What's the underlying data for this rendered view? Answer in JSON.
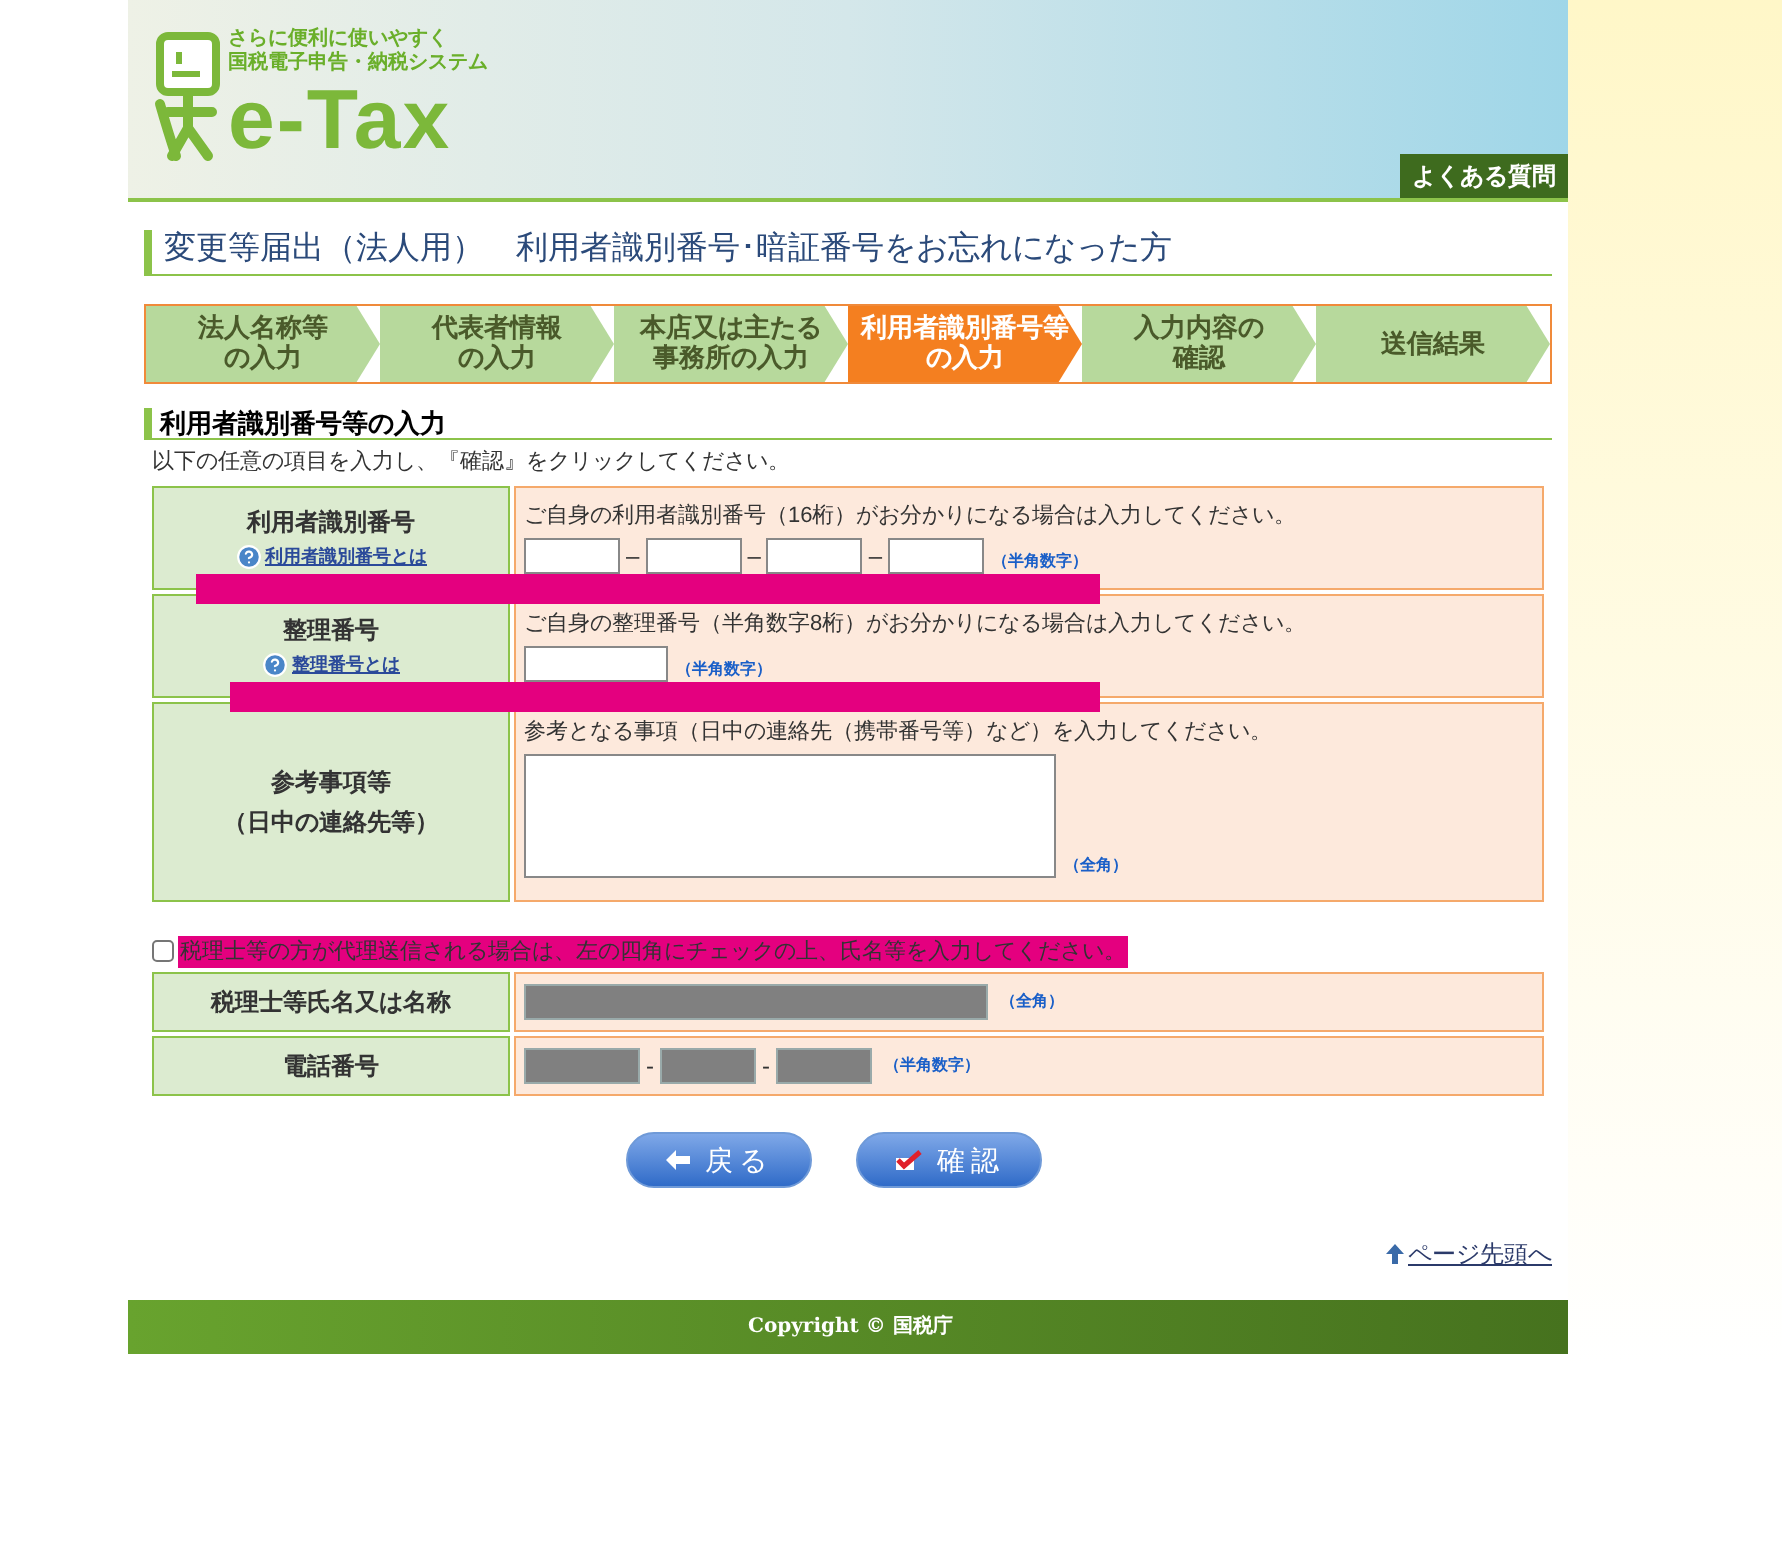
{
  "header": {
    "tagline": [
      "さらに便利に使いやすく",
      "国税電子申告・納税システム"
    ],
    "logo_text": "e-Tax",
    "faq_link": "よくある質問"
  },
  "page_title": "変更等届出（法人用）　利用者識別番号･暗証番号をお忘れになった方",
  "steps": [
    {
      "lines": [
        "法人名称等",
        "の入力"
      ],
      "selected": false
    },
    {
      "lines": [
        "代表者情報",
        "の入力"
      ],
      "selected": false
    },
    {
      "lines": [
        "本店又は主たる",
        "事務所の入力"
      ],
      "selected": false
    },
    {
      "lines": [
        "利用者識別番号等",
        "の入力"
      ],
      "selected": true
    },
    {
      "lines": [
        "入力内容の",
        "確認"
      ],
      "selected": false
    },
    {
      "lines": [
        "送信結果"
      ],
      "selected": false
    }
  ],
  "section_title": "利用者識別番号等の入力",
  "instructions": "以下の任意の項目を入力し、『確認』をクリックしてください。",
  "rows": [
    {
      "kind": "inputs",
      "label": [
        "利用者識別番号"
      ],
      "help_link": "利用者識別番号とは",
      "note": "ご自身の利用者識別番号（16桁）がお分かりになる場合は入力してください。",
      "inputs": [
        {
          "kind": "short",
          "disabled": false
        },
        {
          "kind": "short",
          "disabled": false
        },
        {
          "kind": "short",
          "disabled": false
        },
        {
          "kind": "short",
          "disabled": false
        }
      ],
      "separator": "–",
      "hint": "（半角数字）"
    },
    {
      "kind": "inputs",
      "label": [
        "整理番号"
      ],
      "help_link": "整理番号とは",
      "note": "ご自身の整理番号（半角数字8桁）がお分かりになる場合は入力してください。",
      "inputs": [
        {
          "kind": "medium",
          "disabled": false
        }
      ],
      "hint": "（半角数字）"
    },
    {
      "kind": "textarea",
      "label": [
        "参考事項等",
        "（日中の連絡先等）"
      ],
      "note": "参考となる事項（日中の連絡先（携帯番号等）など）を入力してください。",
      "hint": "（全角）"
    }
  ],
  "agent_checkbox": {
    "checked": false,
    "label": "税理士等の方が代理送信される場合は、左の四角にチェックの上、氏名等を入力してください。"
  },
  "agent_rows": [
    {
      "label": "税理士等氏名又は名称",
      "inputs": [
        {
          "kind": "wide",
          "disabled": true
        }
      ],
      "hint": "（全角）"
    },
    {
      "label": "電話番号",
      "inputs": [
        {
          "kind": "phone",
          "disabled": true
        },
        {
          "kind": "short",
          "disabled": true
        },
        {
          "kind": "short",
          "disabled": true
        }
      ],
      "separator": "-",
      "hint": "（半角数字）"
    }
  ],
  "buttons": [
    {
      "kind": "back",
      "label": "戻る"
    },
    {
      "kind": "confirm",
      "label": "確認"
    }
  ],
  "top_link": "ページ先頭へ",
  "footer": "Copyright © 国税庁"
}
